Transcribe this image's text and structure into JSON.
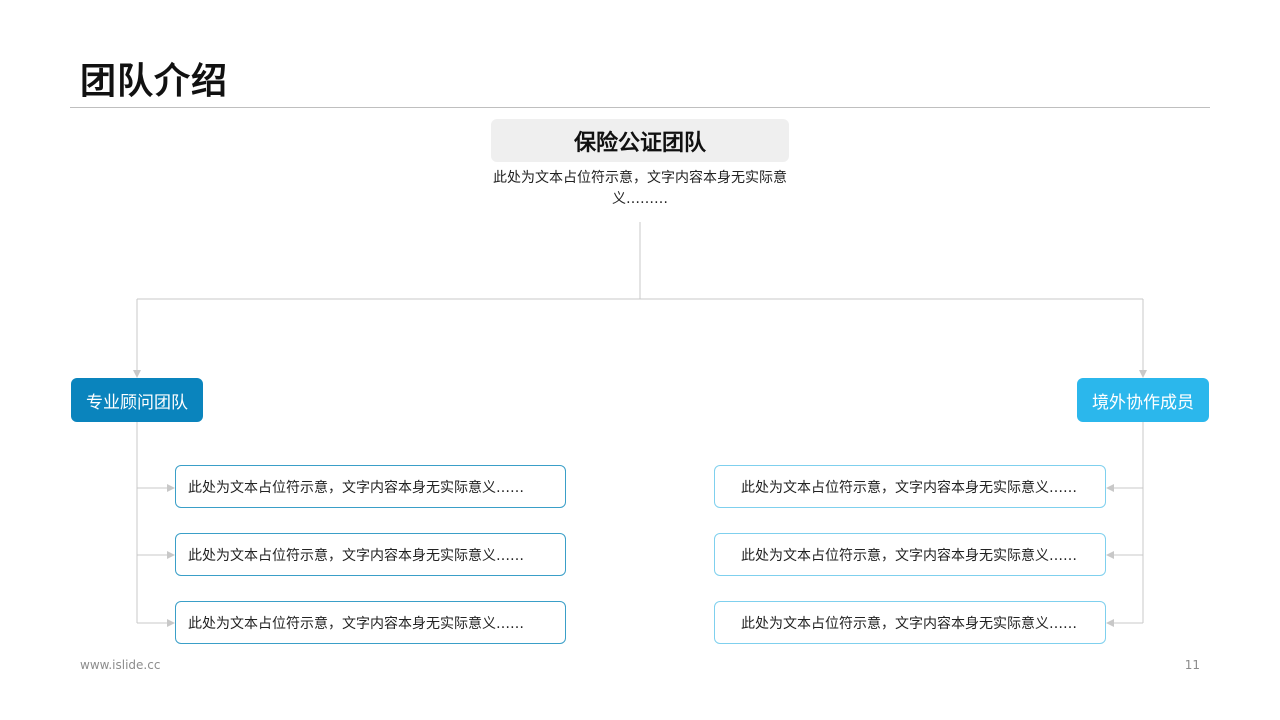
{
  "slide": {
    "title": "团队介绍",
    "footer_url": "www.islide.cc",
    "page_number": "11"
  },
  "org": {
    "root": {
      "label": "保险公证团队",
      "description": "此处为文本占位符示意，文字内容本身无实际意义………"
    },
    "left_branch": {
      "label": "专业顾问团队",
      "items": [
        "此处为文本占位符示意，文字内容本身无实际意义……",
        "此处为文本占位符示意，文字内容本身无实际意义……",
        "此处为文本占位符示意，文字内容本身无实际意义……"
      ]
    },
    "right_branch": {
      "label": "境外协作成员",
      "items": [
        "此处为文本占位符示意，文字内容本身无实际意义……",
        "此处为文本占位符示意，文字内容本身无实际意义……",
        "此处为文本占位符示意，文字内容本身无实际意义……"
      ]
    }
  },
  "colors": {
    "left_branch": "#0a84bd",
    "right_branch": "#2bb7ec",
    "connector": "#c8c8c8",
    "root_box": "#efefef"
  }
}
